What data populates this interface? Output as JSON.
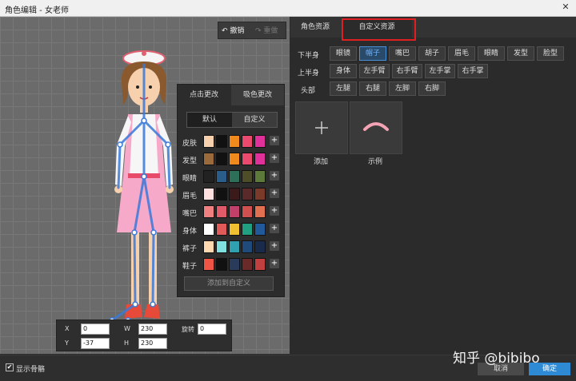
{
  "window": {
    "title": "角色编辑 - 女老师",
    "close_glyph": "✕"
  },
  "toolbar": {
    "undo_label": "撤销",
    "redo_label": "重做"
  },
  "color_panel": {
    "tabs": [
      "点击更改",
      "吸色更改"
    ],
    "modes": [
      "默认",
      "自定义"
    ],
    "rows": [
      {
        "label": "皮肤",
        "swatches": [
          "#f7d1ae",
          "#111111",
          "#f08a1c",
          "#e94a6e",
          "#e0309a"
        ]
      },
      {
        "label": "发型",
        "swatches": [
          "#9a6a3a",
          "#111111",
          "#f08a1c",
          "#e94a6e",
          "#e0309a"
        ]
      },
      {
        "label": "眼睛",
        "swatches": [
          "#222222",
          "#2a5d8a",
          "#2e6f5a",
          "#4d4d2a",
          "#5d7a3a"
        ]
      },
      {
        "label": "眉毛",
        "swatches": [
          "#ffe0e0",
          "#111111",
          "#3a1a1a",
          "#5a2a2a",
          "#7a3a2a"
        ]
      },
      {
        "label": "嘴巴",
        "swatches": [
          "#f08080",
          "#e05a6a",
          "#c0406a",
          "#d05050",
          "#e07050"
        ]
      },
      {
        "label": "身体",
        "swatches": [
          "#ffffff",
          "#e05a5a",
          "#f0c030",
          "#20a080",
          "#205a9a"
        ]
      },
      {
        "label": "裤子",
        "swatches": [
          "#ffd8b0",
          "#80e0e0",
          "#30a0b0",
          "#204a7a",
          "#1a2a4a"
        ]
      },
      {
        "label": "鞋子",
        "swatches": [
          "#ee5544",
          "#111111",
          "#2a3a5a",
          "#6a2a2a",
          "#c04040"
        ]
      }
    ],
    "add_custom_label": "添加到自定义"
  },
  "coords": {
    "x_label": "X",
    "x_value": "0",
    "y_label": "Y",
    "y_value": "-37",
    "w_label": "W",
    "w_value": "230",
    "h_label": "H",
    "h_value": "230",
    "rot_label": "旋转",
    "rot_value": "0"
  },
  "bottom": {
    "show_bones_label": "显示骨骼",
    "check_glyph": "✔",
    "cancel_label": "取消",
    "ok_label": "确定"
  },
  "watermark": "知乎 @bibibo",
  "right_panel": {
    "tabs": [
      "角色资源",
      "自定义资源"
    ],
    "row_labels": [
      "下半身",
      "上半身",
      "头部"
    ],
    "row1": [
      "眼镜",
      "帽子",
      "嘴巴",
      "胡子",
      "眉毛",
      "眼睛",
      "发型",
      "脸型"
    ],
    "row2": [
      "身体",
      "左手臂",
      "右手臂",
      "左手掌",
      "右手掌"
    ],
    "row3": [
      "左腿",
      "右腿",
      "左脚",
      "右脚"
    ],
    "active_part": "帽子",
    "tiles": [
      {
        "label": "添加"
      },
      {
        "label": "示例"
      }
    ]
  },
  "colors": {
    "accent": "#2f8ad6",
    "highlight": "#e02020",
    "active_text": "#6fb3ff"
  }
}
